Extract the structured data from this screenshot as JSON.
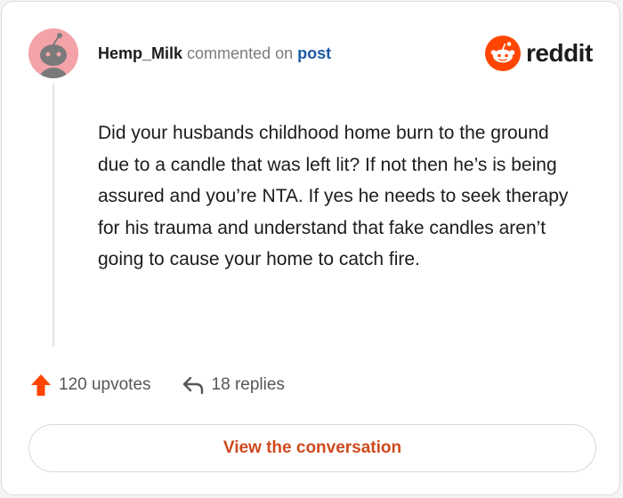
{
  "comment": {
    "username": "Hemp_Milk",
    "action_text": "commented on",
    "target_link": "post",
    "body": "Did your husbands childhood home burn to the ground due to a candle that was left lit? If not then he’s is being assured and you’re NTA. If yes he needs to seek therapy for his trauma and understand that fake candles aren’t going to cause your home to catch fire."
  },
  "brand": {
    "wordmark": "reddit",
    "logo_icon": "reddit-snoo-icon",
    "accent_color": "#ff4500"
  },
  "stats": {
    "upvotes_label": "120 upvotes",
    "replies_label": "18 replies",
    "upvote_icon": "upvote-arrow-icon",
    "reply_icon": "reply-arrow-icon"
  },
  "cta": {
    "label": "View the conversation"
  },
  "avatar": {
    "icon": "snoo-avatar-icon",
    "background_color": "#f3a3a8"
  }
}
